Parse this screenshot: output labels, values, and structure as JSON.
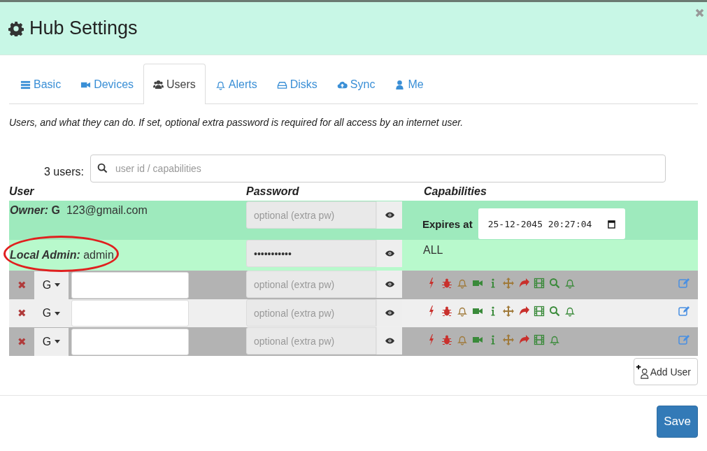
{
  "window": {
    "title": "Hub Settings"
  },
  "tabs": [
    {
      "label": "Basic",
      "kind": "server",
      "selected": false
    },
    {
      "label": "Devices",
      "kind": "video",
      "selected": false
    },
    {
      "label": "Users",
      "kind": "users",
      "selected": true
    },
    {
      "label": "Alerts",
      "kind": "bell",
      "selected": false
    },
    {
      "label": "Disks",
      "kind": "disk",
      "selected": false
    },
    {
      "label": "Sync",
      "kind": "cloud",
      "selected": false
    },
    {
      "label": "Me",
      "kind": "user",
      "selected": false
    }
  ],
  "description": "Users, and what they can do. If set, optional extra password is required for all access by an internet user.",
  "search": {
    "label": "3 users:",
    "placeholder": "user id / capabilities"
  },
  "columns": [
    "User",
    "Password",
    "Capabilities"
  ],
  "owner": {
    "label": "Owner:",
    "provider": "G",
    "email": "123@gmail.com",
    "password_placeholder": "optional (extra pw)",
    "expires_label": "Expires at",
    "expires_value": "25-12-2045 20:27:04"
  },
  "admin": {
    "label": "Local Admin:",
    "name": "admin",
    "password_value": "•••••••••••",
    "capabilities": "ALL",
    "highlighted": true
  },
  "users": [
    {
      "remove": "✖",
      "provider": "G",
      "password_placeholder": "optional (extra pw)",
      "capabilities": [
        {
          "kind": "bolt"
        },
        {
          "kind": "bug"
        },
        {
          "kind": "bell"
        },
        {
          "kind": "video"
        },
        {
          "kind": "info"
        },
        {
          "kind": "move"
        },
        {
          "kind": "share"
        },
        {
          "kind": "film"
        },
        {
          "kind": "search"
        },
        {
          "kind": "bell-green"
        }
      ]
    },
    {
      "remove": "✖",
      "provider": "G",
      "password_placeholder": "optional (extra pw)",
      "capabilities": [
        {
          "kind": "bolt"
        },
        {
          "kind": "bug"
        },
        {
          "kind": "bell"
        },
        {
          "kind": "video"
        },
        {
          "kind": "info"
        },
        {
          "kind": "move"
        },
        {
          "kind": "share"
        },
        {
          "kind": "film"
        },
        {
          "kind": "search"
        },
        {
          "kind": "bell-green"
        }
      ]
    },
    {
      "remove": "✖",
      "provider": "G",
      "password_placeholder": "optional (extra pw)",
      "capabilities": [
        {
          "kind": "bolt"
        },
        {
          "kind": "bug"
        },
        {
          "kind": "bell"
        },
        {
          "kind": "video"
        },
        {
          "kind": "info"
        },
        {
          "kind": "move"
        },
        {
          "kind": "share"
        },
        {
          "kind": "film"
        },
        {
          "kind": "bell-green"
        }
      ]
    }
  ],
  "add_button": "Add User",
  "save_button": "Save"
}
